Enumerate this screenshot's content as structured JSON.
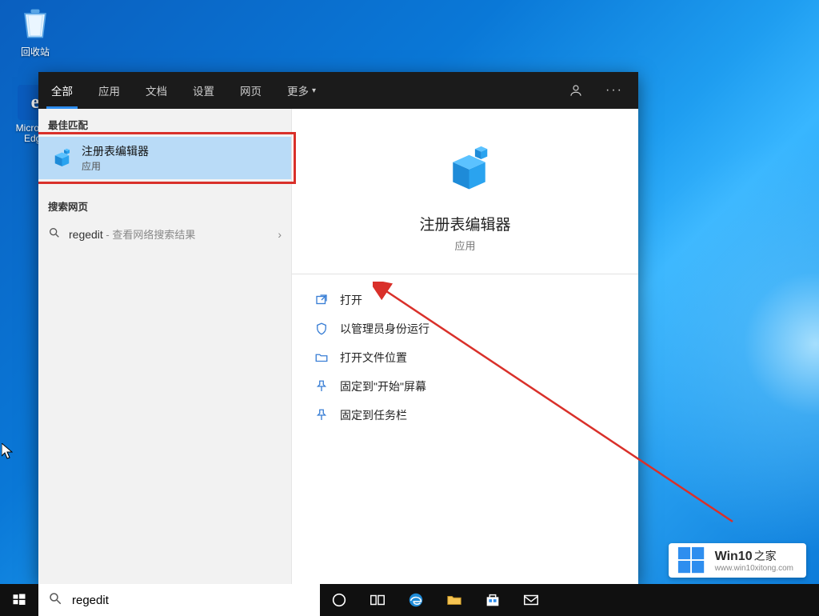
{
  "desktop": {
    "recycle_label": "回收站",
    "edge_label": "Microsoft Edge"
  },
  "search_panel": {
    "tabs": [
      "全部",
      "应用",
      "文档",
      "设置",
      "网页",
      "更多"
    ],
    "best_match_label": "最佳匹配",
    "result": {
      "title": "注册表编辑器",
      "subtitle": "应用"
    },
    "web_section_label": "搜索网页",
    "web_item": {
      "term": "regedit",
      "suffix": " - 查看网络搜索结果"
    },
    "preview": {
      "title": "注册表编辑器",
      "subtitle": "应用"
    },
    "actions": [
      "打开",
      "以管理员身份运行",
      "打开文件位置",
      "固定到\"开始\"屏幕",
      "固定到任务栏"
    ]
  },
  "taskbar": {
    "search_value": "regedit"
  },
  "watermark": {
    "brand": "Win10",
    "suffix": "之家",
    "url": "www.win10xitong.com"
  }
}
